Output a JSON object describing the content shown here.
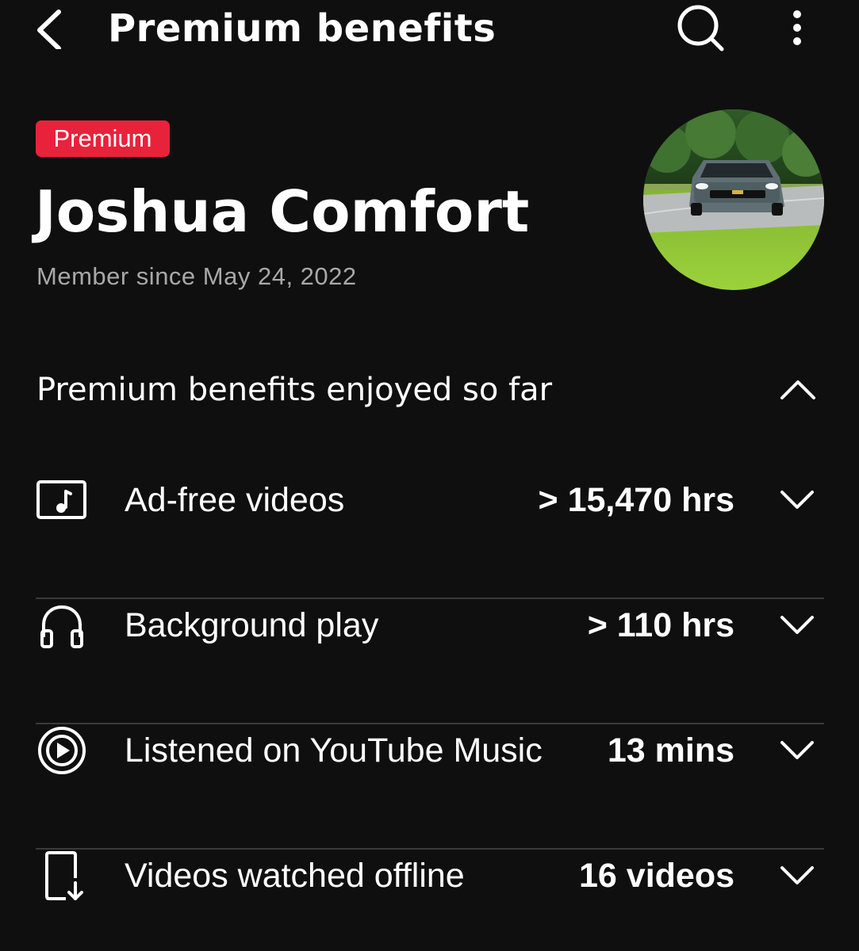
{
  "header": {
    "title": "Premium benefits",
    "icons": {
      "back": "back-arrow-icon",
      "search": "search-icon",
      "more": "more-vert-icon"
    }
  },
  "profile": {
    "badge": "Premium",
    "name": "Joshua Comfort",
    "member_since": "Member since May 24, 2022",
    "avatar": "car-photo-avatar"
  },
  "benefits": {
    "title": "Premium benefits enjoyed so far",
    "items": [
      {
        "icon": "music-video-icon",
        "label": "Ad-free videos",
        "value": "> 15,470 hrs"
      },
      {
        "icon": "headphones-icon",
        "label": "Background play",
        "value": "> 110 hrs"
      },
      {
        "icon": "youtube-music-icon",
        "label": "Listened on YouTube Music",
        "value": "13 mins"
      },
      {
        "icon": "offline-download-icon",
        "label": "Videos watched offline",
        "value": "16 videos"
      }
    ]
  },
  "colors": {
    "background": "#0f0f10",
    "badge": "#e8223a",
    "divider": "#3a3a3c",
    "secondary_text": "#a8a8a8"
  }
}
